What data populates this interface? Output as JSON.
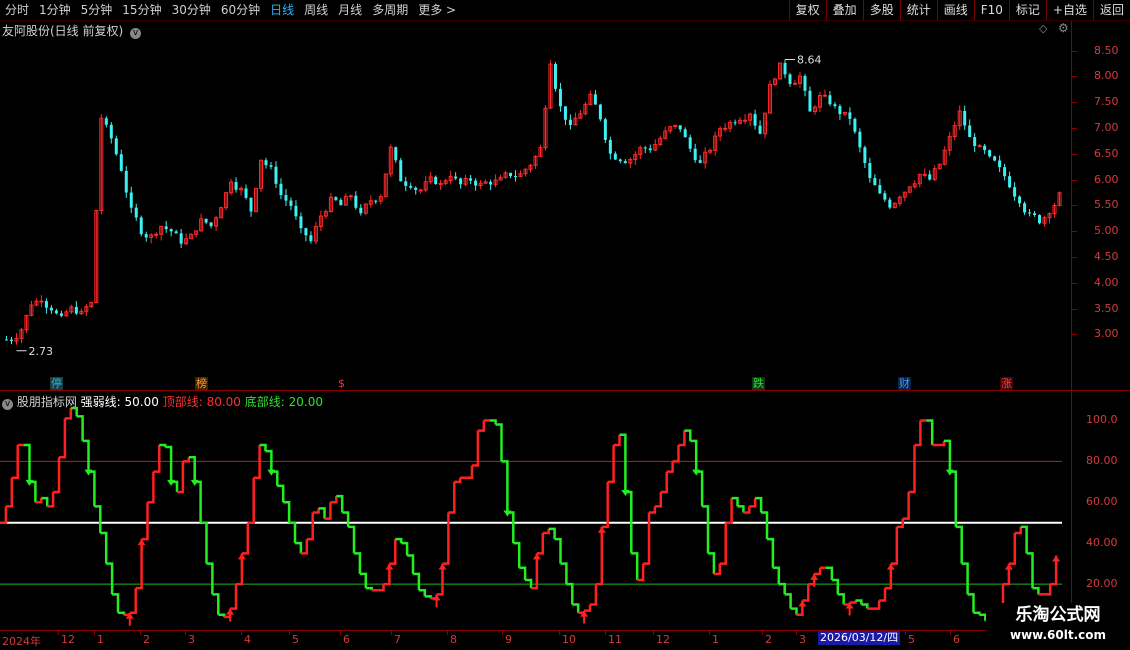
{
  "toolbar": {
    "periods": [
      "分时",
      "1分钟",
      "5分钟",
      "15分钟",
      "30分钟",
      "60分钟",
      "日线",
      "周线",
      "月线",
      "多周期",
      "更多 >"
    ],
    "active_period": "日线",
    "right_buttons": [
      "复权",
      "叠加",
      "多股",
      "统计",
      "画线",
      "F10",
      "标记",
      "+自选",
      "返回"
    ]
  },
  "main": {
    "title": "友阿股份(日线 前复权)",
    "high_label": "8.64",
    "low_label": "2.73",
    "y_ticks": [
      "8.50",
      "8.00",
      "7.50",
      "7.00",
      "6.50",
      "6.00",
      "5.50",
      "5.00",
      "4.50",
      "4.00",
      "3.50",
      "3.00"
    ],
    "markers": [
      {
        "text": "停",
        "color": "#2fb7c9",
        "bg": "#1a3b44"
      },
      {
        "text": "榜",
        "color": "#ff9c2a",
        "bg": "#402400"
      },
      {
        "text": "$",
        "color": "#ff3030",
        "bg": "#000000"
      },
      {
        "text": "跌",
        "color": "#30e030",
        "bg": "#10351a"
      },
      {
        "text": "财",
        "color": "#3aa0ff",
        "bg": "#0c2240"
      },
      {
        "text": "涨",
        "color": "#ff4040",
        "bg": "#3a0a0a"
      }
    ]
  },
  "indicator": {
    "name": "股朋指标网",
    "strong_label": "强弱线: 50.00",
    "top_label": "顶部线: 80.00",
    "bottom_label": "底部线: 20.00",
    "y_ticks": [
      "100.0",
      "80.00",
      "60.00",
      "40.00",
      "20.00"
    ]
  },
  "xaxis": {
    "labels": [
      "2024年",
      "12",
      "1",
      "2",
      "3",
      "4",
      "5",
      "6",
      "7",
      "8",
      "9",
      "10",
      "11",
      "12",
      "1",
      "2",
      "3",
      "5",
      "6"
    ],
    "selected_date": "2026/03/12/四"
  },
  "watermark": {
    "title": "乐淘公式网",
    "url": "www.60lt.com"
  },
  "colors": {
    "up": "#ff2a2a",
    "down": "#40f0f0",
    "ind_up": "#ff2020",
    "ind_down": "#22ee22",
    "grid": "#8a0000",
    "axis_text": "#d23b3b"
  },
  "chart_data": [
    {
      "type": "candlestick",
      "title": "友阿股份(日线 前复权)",
      "ylim": [
        2.6,
        8.9
      ],
      "close_path": [
        2.9,
        3.1,
        3.6,
        3.7,
        3.5,
        3.3,
        3.5,
        3.4,
        3.6,
        7.2,
        6.8,
        6.2,
        5.4,
        5.0,
        4.9,
        5.1,
        5.0,
        4.8,
        4.9,
        5.2,
        5.1,
        5.5,
        6.0,
        5.8,
        5.4,
        6.4,
        6.2,
        5.7,
        5.5,
        5.0,
        4.8,
        5.3,
        5.6,
        5.5,
        5.7,
        5.3,
        5.6,
        5.7,
        6.6,
        6.0,
        5.9,
        5.8,
        6.0,
        5.9,
        6.1,
        5.9,
        6.0,
        5.9,
        5.95,
        6.0,
        6.1,
        6.1,
        6.3,
        6.6,
        8.3,
        7.4,
        7.0,
        7.3,
        7.6,
        7.2,
        6.5,
        6.4,
        6.4,
        6.6,
        6.6,
        6.8,
        7.0,
        7.0,
        6.6,
        6.3,
        6.6,
        7.0,
        7.1,
        7.2,
        7.3,
        6.9,
        7.8,
        8.2,
        7.9,
        8.0,
        7.3,
        7.6,
        7.5,
        7.3,
        7.2,
        6.6,
        6.0,
        5.7,
        5.5,
        5.7,
        5.9,
        6.1,
        6.0,
        6.3,
        6.8,
        7.3,
        6.8,
        6.6,
        6.4,
        6.2,
        5.9,
        5.6,
        5.3,
        5.2,
        5.4,
        5.7
      ],
      "high": 8.64,
      "low": 2.73
    },
    {
      "type": "line",
      "series": [
        {
          "name": "强弱线",
          "values": [
            50
          ]
        },
        {
          "name": "顶部线",
          "values": [
            80
          ]
        },
        {
          "name": "底部线",
          "values": [
            20
          ]
        }
      ],
      "ylim": [
        0,
        110
      ],
      "main_path": [
        50,
        58,
        72,
        88,
        88,
        70,
        60,
        62,
        58,
        65,
        82,
        101,
        106,
        102,
        90,
        75,
        58,
        45,
        30,
        15,
        6,
        5,
        6,
        18,
        42,
        60,
        75,
        88,
        87,
        70,
        65,
        80,
        82,
        70,
        50,
        30,
        15,
        5,
        4,
        8,
        20,
        35,
        50,
        72,
        88,
        85,
        75,
        68,
        60,
        50,
        40,
        35,
        42,
        55,
        57,
        52,
        60,
        63,
        55,
        48,
        35,
        25,
        18,
        17,
        17,
        20,
        30,
        42,
        40,
        34,
        25,
        17,
        14,
        13,
        15,
        30,
        55,
        70,
        72,
        72,
        78,
        95,
        100,
        100,
        98,
        80,
        55,
        40,
        28,
        22,
        18,
        35,
        45,
        47,
        42,
        30,
        20,
        10,
        6,
        7,
        10,
        20,
        48,
        70,
        88,
        93,
        65,
        35,
        22,
        30,
        55,
        58,
        65,
        75,
        80,
        88,
        95,
        90,
        75,
        58,
        35,
        25,
        30,
        50,
        62,
        58,
        55,
        58,
        62,
        55,
        42,
        28,
        20,
        15,
        8,
        5,
        12,
        20,
        25,
        28,
        28,
        22,
        15,
        10,
        11,
        12,
        10,
        8,
        8,
        12,
        18,
        30,
        48,
        52,
        65,
        88,
        100,
        100,
        88,
        88,
        90,
        75,
        48,
        30,
        15,
        6,
        5,
        2,
        4,
        10,
        20,
        30,
        45,
        48,
        35,
        18,
        15,
        15,
        20,
        34
      ]
    }
  ]
}
